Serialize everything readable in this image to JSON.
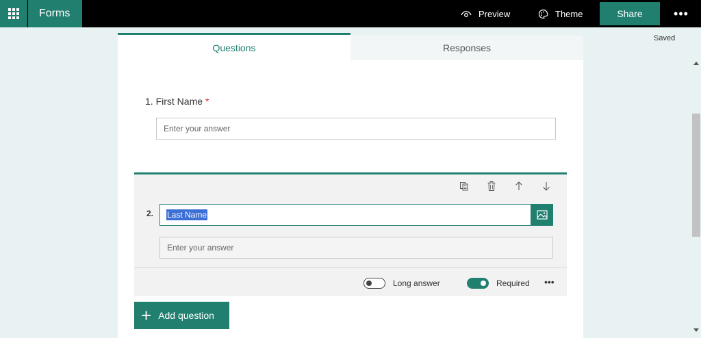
{
  "topbar": {
    "app_name": "Forms",
    "preview_label": "Preview",
    "theme_label": "Theme",
    "share_label": "Share",
    "more_label": "•••"
  },
  "status": {
    "saved": "Saved"
  },
  "tabs": [
    {
      "label": "Questions",
      "active": true
    },
    {
      "label": "Responses",
      "active": false
    }
  ],
  "questions": [
    {
      "title": "1. First Name",
      "required_mark": "*",
      "answer_placeholder": "Enter your answer"
    },
    {
      "number": "2.",
      "title": "Last Name",
      "answer_placeholder": "Enter your answer",
      "long_answer_label": "Long answer",
      "long_answer": false,
      "required_label": "Required",
      "required": true,
      "more_label": "•••"
    }
  ],
  "add_question": {
    "label": "Add question"
  },
  "colors": {
    "accent": "#217f70",
    "required": "#d13438",
    "selection": "#3b6fd6"
  },
  "icons": [
    "app-launcher-icon",
    "eye-icon",
    "palette-icon",
    "copy-icon",
    "trash-icon",
    "arrow-up-icon",
    "arrow-down-icon",
    "image-icon",
    "plus-icon"
  ]
}
